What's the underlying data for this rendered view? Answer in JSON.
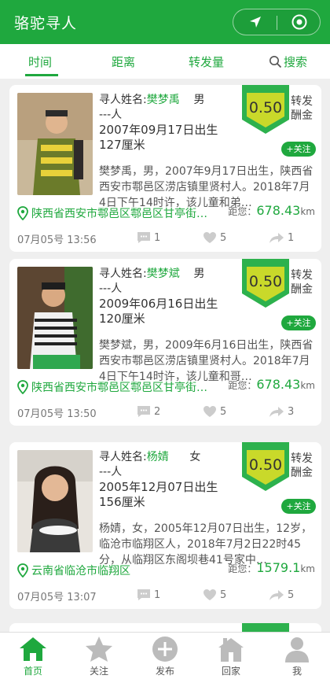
{
  "app": {
    "title": "骆驼寻人"
  },
  "tabs": [
    {
      "label": "时间",
      "active": true
    },
    {
      "label": "距离",
      "active": false
    },
    {
      "label": "转发量",
      "active": false
    },
    {
      "label": "搜索",
      "icon": "search-icon",
      "active": false
    }
  ],
  "cards": [
    {
      "name_prefix": "寻人姓名:",
      "name": "樊梦禹",
      "gender": "男",
      "line2": "---人",
      "birth": "2007年09月17日出生",
      "height": "127厘米",
      "reward_value": "0.50",
      "reward_label_1": "转发",
      "reward_label_2": "酬金",
      "follow": "+关注",
      "desc": "樊梦禹，男，2007年9月17日出生，陕西省西安市鄠邑区涝店镇里贤村人。2018年7月4日下午14时许，该儿童和弟…",
      "location": "陕西省西安市鄠邑区鄠邑区甘亭街…",
      "distance_label": "距您：",
      "distance": "678.43",
      "distance_unit": "km",
      "date": "07月05号 13:56",
      "comments": "1",
      "likes": "5",
      "shares": "1"
    },
    {
      "name_prefix": "寻人姓名:",
      "name": "樊梦斌",
      "gender": "男",
      "line2": "---人",
      "birth": "2009年06月16日出生",
      "height": "120厘米",
      "reward_value": "0.50",
      "reward_label_1": "转发",
      "reward_label_2": "酬金",
      "follow": "+关注",
      "desc": "樊梦斌，男，2009年6月16日出生，陕西省西安市鄠邑区涝店镇里贤村人。2018年7月4日下午14时许，该儿童和哥…",
      "location": "陕西省西安市鄠邑区鄠邑区甘亭街…",
      "distance_label": "距您：",
      "distance": "678.43",
      "distance_unit": "km",
      "date": "07月05号 13:50",
      "comments": "2",
      "likes": "5",
      "shares": "3"
    },
    {
      "name_prefix": "寻人姓名:",
      "name": "杨婧",
      "gender": "女",
      "line2": "---人",
      "birth": "2005年12月07日出生",
      "height": "156厘米",
      "reward_value": "0.50",
      "reward_label_1": "转发",
      "reward_label_2": "酬金",
      "follow": "+关注",
      "desc": "杨婧，女，2005年12月07日出生，12岁，临沧市临翔区人，2018年7月2日22时45分，从临翔区东阁坝巷41号家中…",
      "location": "云南省临沧市临翔区",
      "distance_label": "距您：",
      "distance": "1579.1",
      "distance_unit": "km",
      "date": "07月05号 13:07",
      "comments": "1",
      "likes": "5",
      "shares": "5"
    }
  ],
  "tabbar": [
    {
      "label": "首页",
      "icon": "home-icon",
      "active": true
    },
    {
      "label": "关注",
      "icon": "star-icon",
      "active": false
    },
    {
      "label": "发布",
      "icon": "plus-circle-icon",
      "active": false
    },
    {
      "label": "回家",
      "icon": "house-icon",
      "active": false
    },
    {
      "label": "我",
      "icon": "user-icon",
      "active": false
    }
  ],
  "colors": {
    "brand": "#1fa83e",
    "flag": "#2db14d",
    "flag_inner": "#c9d92a"
  }
}
